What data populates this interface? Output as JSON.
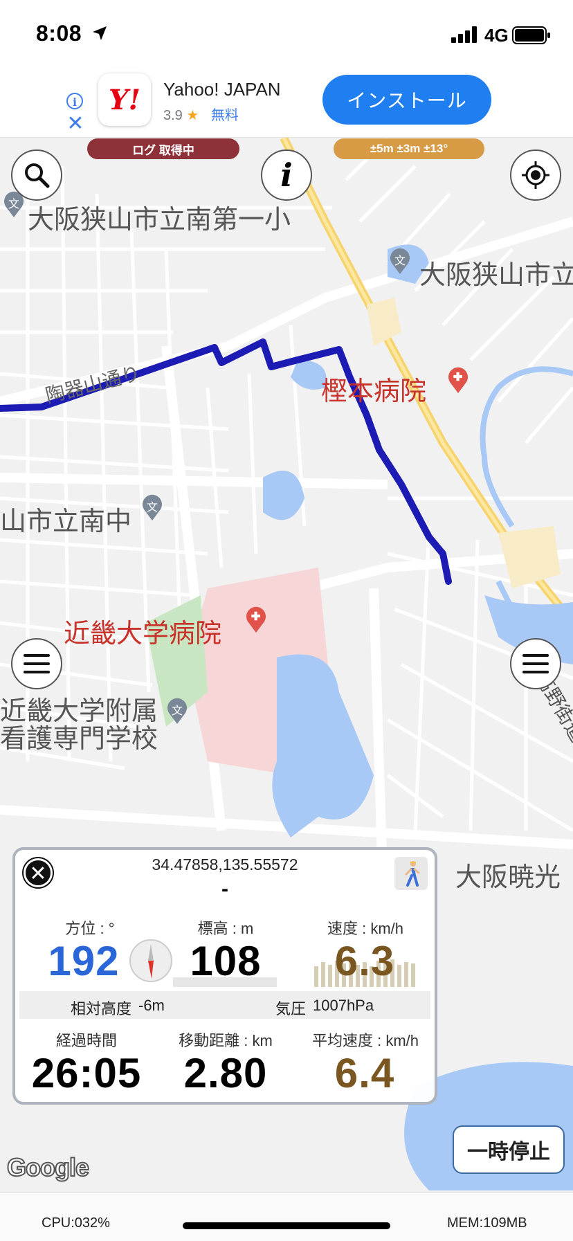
{
  "statusbar": {
    "time": "8:08",
    "network": "4G"
  },
  "ad": {
    "logo_text": "Y!",
    "app_name": "Yahoo! JAPAN",
    "rating": "3.9",
    "star": "★",
    "price": "無料",
    "install_label": "インストール",
    "info_glyph": "i",
    "close_glyph": "✕"
  },
  "map": {
    "status_pill": "ログ 取得中",
    "accuracy_pill": "±5m ±3m ±13°",
    "info_glyph": "i",
    "labels": {
      "school1": "大阪狭山市立南第一小",
      "school2": "大阪狭山市立",
      "road": "陶器山通り",
      "hospital1": "樫本病院",
      "school3": "山市立南中",
      "hospital2": "近畿大学病院",
      "school4_l1": "近畿大学附属",
      "school4_l2": "看護専門学校",
      "highway": "高野街道",
      "school5": "大阪暁光"
    },
    "google_logo": "Google"
  },
  "panel": {
    "close_glyph": "✕",
    "coords": "34.47858,135.55572",
    "address": "-",
    "heading_label": "方位 : °",
    "heading_value": "192",
    "elevation_label": "標高 : m",
    "elevation_value": "108",
    "speed_label": "速度 : km/h",
    "speed_value": "6.3",
    "rel_alt_label": "相対高度",
    "rel_alt_value": "-6m",
    "pressure_label": "気圧",
    "pressure_value": "1007hPa",
    "elapsed_label": "経過時間",
    "elapsed_value": "26:05",
    "distance_label": "移動距離 : km",
    "distance_value": "2.80",
    "avg_speed_label": "平均速度 : km/h",
    "avg_speed_value": "6.4"
  },
  "controls": {
    "pause_label": "一時停止"
  },
  "footer": {
    "cpu": "CPU:032%",
    "mem": "MEM:109MB"
  },
  "colors": {
    "track": "#1c1cb4",
    "accent_blue": "#2a66d8",
    "brown": "#7a5621",
    "log_pill": "#8f3138",
    "acc_pill": "#d79a45",
    "install": "#1f7ef0"
  }
}
